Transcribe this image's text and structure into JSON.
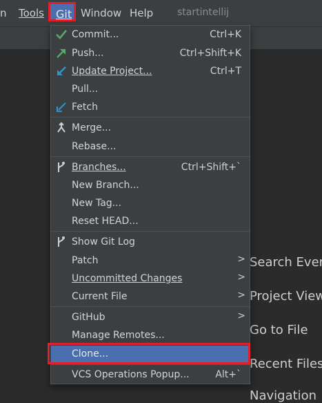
{
  "menubar": {
    "items": [
      {
        "label": "n"
      },
      {
        "label": "Tools"
      },
      {
        "label": "Git"
      },
      {
        "label": "Window"
      },
      {
        "label": "Help"
      }
    ],
    "project_title": "startintellij"
  },
  "welcome": {
    "links": [
      "Search Every",
      "Project View",
      "Go to File",
      "Recent Files",
      "Navigation"
    ]
  },
  "git_menu": {
    "items": [
      {
        "label": "Commit...",
        "shortcut": "Ctrl+K",
        "icon": "check-icon"
      },
      {
        "label": "Push...",
        "shortcut": "Ctrl+Shift+K",
        "icon": "push-arrow-icon"
      },
      {
        "label": "Update Project...",
        "shortcut": "Ctrl+T",
        "icon": "update-arrow-icon"
      },
      {
        "label": "Pull...",
        "shortcut": ""
      },
      {
        "label": "Fetch",
        "shortcut": "",
        "icon": "fetch-icon"
      },
      {
        "label": "Merge...",
        "shortcut": "",
        "icon": "merge-icon"
      },
      {
        "label": "Rebase...",
        "shortcut": ""
      },
      {
        "label": "Branches...",
        "shortcut": "Ctrl+Shift+`",
        "icon": "branch-icon"
      },
      {
        "label": "New Branch...",
        "shortcut": ""
      },
      {
        "label": "New Tag...",
        "shortcut": ""
      },
      {
        "label": "Reset HEAD...",
        "shortcut": ""
      },
      {
        "label": "Show Git Log",
        "shortcut": "",
        "icon": "git-log-icon"
      },
      {
        "label": "Patch",
        "submenu": true
      },
      {
        "label": "Uncommitted Changes",
        "submenu": true
      },
      {
        "label": "Current File",
        "submenu": true
      },
      {
        "label": "GitHub",
        "submenu": true
      },
      {
        "label": "Manage Remotes...",
        "shortcut": ""
      },
      {
        "label": "Clone...",
        "shortcut": "",
        "selected": true
      },
      {
        "label": "VCS Operations Popup...",
        "shortcut": "Alt+`"
      }
    ],
    "submenu_arrow": ">"
  },
  "colors": {
    "menu_bg": "#3c3f41",
    "selection": "#4b6eaf",
    "highlight_outline": "#e0202a",
    "check_green": "#59a869",
    "push_green": "#59a869",
    "update_blue": "#3592c4"
  }
}
